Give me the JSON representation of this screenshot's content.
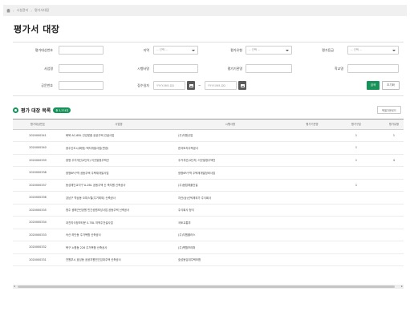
{
  "breadcrumb": [
    "시설관리",
    "평가서대장"
  ],
  "page_title": "평가서 대장",
  "search": {
    "evaluation_no_label": "평가대상번호",
    "region_label": "지역",
    "region_value": "-- 선택 --",
    "eval_type_label": "평가유형",
    "eval_type_value": "-- 선택 --",
    "eval_grade_label": "평가등급",
    "eval_grade_value": "-- 선택 --",
    "project_name_label": "사업명",
    "operator_label": "시행사명",
    "eval_agency_label": "평가기관명",
    "school_label": "학교명",
    "doc_no_label": "공문번호",
    "received_date_label": "접수일자",
    "date_from_placeholder": "YYYY-MM-DD",
    "date_to_placeholder": "YYYY-MM-DD",
    "tilde": "~",
    "search_button": "검색",
    "reset_button": "초기화"
  },
  "list": {
    "title": "평가 대장 목록",
    "count_badge": "총 3,374건",
    "excel_button": "엑셀다운로드",
    "columns": [
      "평가대상번호",
      "사업명",
      "시행사명",
      "평가기관명",
      "평가구분",
      "평가유형"
    ],
    "rows": [
      {
        "no": "2020000341",
        "project": "화북 AC-6BL 건강맞춤 공공주택 건설사업",
        "operator": "(주)지원산업",
        "agency": "",
        "type": "1",
        "grade": "1"
      },
      {
        "no": "2020000340",
        "project": "광주신도시(화정) 택지개발사업(변경)",
        "operator": "한국토지주택공사",
        "agency": "",
        "type": "1",
        "grade": ""
      },
      {
        "no": "2020000339",
        "project": "광명 주거개선(4단지) 이곳발정주택건",
        "operator": "주거개선(4단지) 이곳발정주택건",
        "agency": "",
        "type": "1",
        "grade": "4"
      },
      {
        "no": "2020000338",
        "project": "광명6R구역 공동주택 주택재개발사업",
        "operator": "광명6R구역 주택재개발정비사업",
        "agency": "",
        "type": "",
        "grade": ""
      },
      {
        "no": "2020000337",
        "project": "동성레인교각구 A-2BL 공동주택 신 축지원 신축공사",
        "operator": "(주)동탑레플건설",
        "agency": "",
        "type": "1",
        "grade": ""
      },
      {
        "no": "2020000336",
        "project": "강남구 역삼동 오피스텔(주거제외) 신축공사",
        "operator": "자산(상)신탁제외가 주식회사",
        "agency": "",
        "type": "",
        "grade": ""
      },
      {
        "no": "2020000335",
        "project": "청주 광해근린공원 민간공원조성사업 공동주택 신축공사",
        "operator": "주식회사 청석",
        "agency": "",
        "type": "",
        "grade": ""
      },
      {
        "no": "2020000334",
        "project": "과천지식정보타운 S-7BL 저액주건설사업",
        "operator": "국토교통부",
        "agency": "",
        "type": "",
        "grade": ""
      },
      {
        "no": "2020000333",
        "project": "속산 하단동 주거복합 신축공사",
        "operator": "(주)지원플러스",
        "agency": "",
        "type": "",
        "grade": ""
      },
      {
        "no": "2020000332",
        "project": "북구 노원동 226 주거복합 신축공사",
        "operator": "(주)벽월프라퍼",
        "agency": "",
        "type": "",
        "grade": ""
      },
      {
        "no": "2020000331",
        "project": "천원부시 효성동 공공지원민간임대주택 신축공사",
        "operator": "효성동임대주택조합",
        "agency": "",
        "type": "",
        "grade": ""
      }
    ]
  }
}
